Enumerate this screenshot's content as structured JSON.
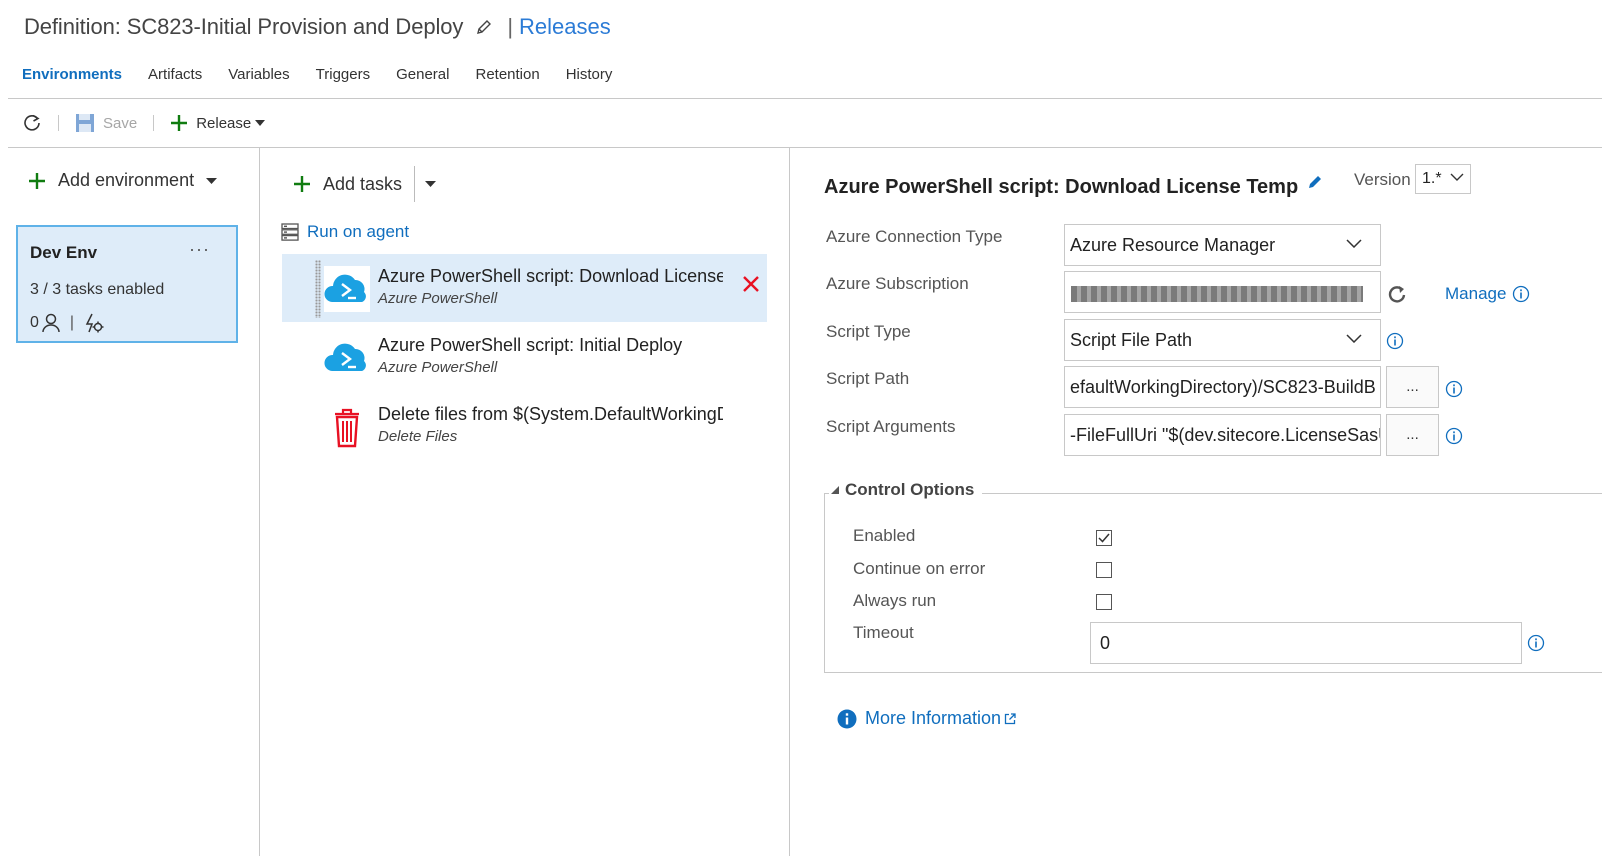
{
  "header": {
    "definition_title": "Definition: SC823-Initial Provision and Deploy",
    "separator": "|",
    "releases_link": "Releases"
  },
  "tabs": [
    {
      "label": "Environments",
      "active": true
    },
    {
      "label": "Artifacts",
      "active": false
    },
    {
      "label": "Variables",
      "active": false
    },
    {
      "label": "Triggers",
      "active": false
    },
    {
      "label": "General",
      "active": false
    },
    {
      "label": "Retention",
      "active": false
    },
    {
      "label": "History",
      "active": false
    }
  ],
  "toolbar": {
    "save_label": "Save",
    "release_label": "Release"
  },
  "environments": {
    "add_label": "Add environment",
    "card": {
      "name": "Dev Env",
      "menu": "···",
      "tasks_status": "3 / 3 tasks enabled",
      "approvers_count": "0",
      "footer_separator": "|"
    }
  },
  "tasks_panel": {
    "add_tasks_label": "Add tasks",
    "run_on_agent_label": "Run on agent",
    "tasks": [
      {
        "name": "Azure PowerShell script: Download License Template",
        "type": "Azure PowerShell",
        "icon": "azure-powershell-icon",
        "selected": true
      },
      {
        "name": "Azure PowerShell script: Initial Deploy",
        "type": "Azure PowerShell",
        "icon": "azure-powershell-icon",
        "selected": false
      },
      {
        "name": "Delete files from $(System.DefaultWorkingDirectory)",
        "type": "Delete Files",
        "icon": "trash-icon",
        "selected": false
      }
    ]
  },
  "task_detail": {
    "title": "Azure PowerShell script: Download License Temp",
    "version_label": "Version",
    "version_value": "1.*",
    "fields": {
      "connection_type": {
        "label": "Azure Connection Type",
        "value": "Azure Resource Manager"
      },
      "subscription": {
        "label": "Azure Subscription",
        "value": ""
      },
      "script_type": {
        "label": "Script Type",
        "value": "Script File Path"
      },
      "script_path": {
        "label": "Script Path",
        "value": " efaultWorkingDirectory)/SC823-BuildB"
      },
      "script_arguments": {
        "label": "Script Arguments",
        "value": "-FileFullUri \"$(dev.sitecore.LicenseSasU"
      }
    },
    "dots_label": "...",
    "manage_label": "Manage",
    "control_options": {
      "title": "Control Options",
      "enabled": {
        "label": "Enabled",
        "checked": true
      },
      "continue_on_error": {
        "label": "Continue on error",
        "checked": false
      },
      "always_run": {
        "label": "Always run",
        "checked": false
      },
      "timeout": {
        "label": "Timeout",
        "value": "0"
      }
    },
    "more_info_label": "More Information"
  },
  "colors": {
    "accent": "#106ebe",
    "link": "#2b7bd6",
    "selected_bg": "#deecf9",
    "card_border": "#5fb2e8",
    "add_green": "#107c10",
    "delete_red": "#e81123",
    "azure_blue": "#1ba1e2"
  }
}
